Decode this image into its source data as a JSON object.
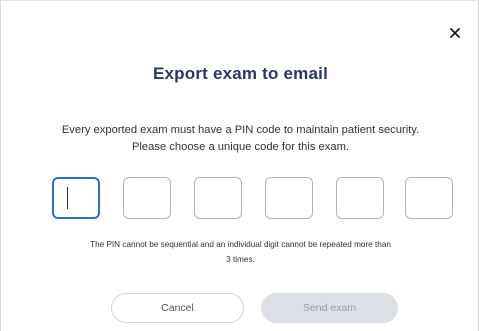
{
  "dialog": {
    "close_icon": "close-icon",
    "title": "Export exam to email",
    "description": [
      "Every exported exam must have a PIN code to maintain patient security.",
      "Please choose a unique code for this exam."
    ],
    "pin": {
      "length": 6,
      "values": [
        "",
        "",
        "",
        "",
        "",
        ""
      ],
      "active_index": 0
    },
    "hint": [
      "The PIN cannot be sequential and an individual digit cannot be repeated more than",
      "3 times."
    ],
    "buttons": {
      "cancel_label": "Cancel",
      "send_label": "Send exam"
    },
    "colors": {
      "title": "#2e3566",
      "active_border": "#2f6fc7",
      "disabled_button_bg": "#dcdfe6",
      "disabled_button_text": "#9a9fae"
    }
  }
}
